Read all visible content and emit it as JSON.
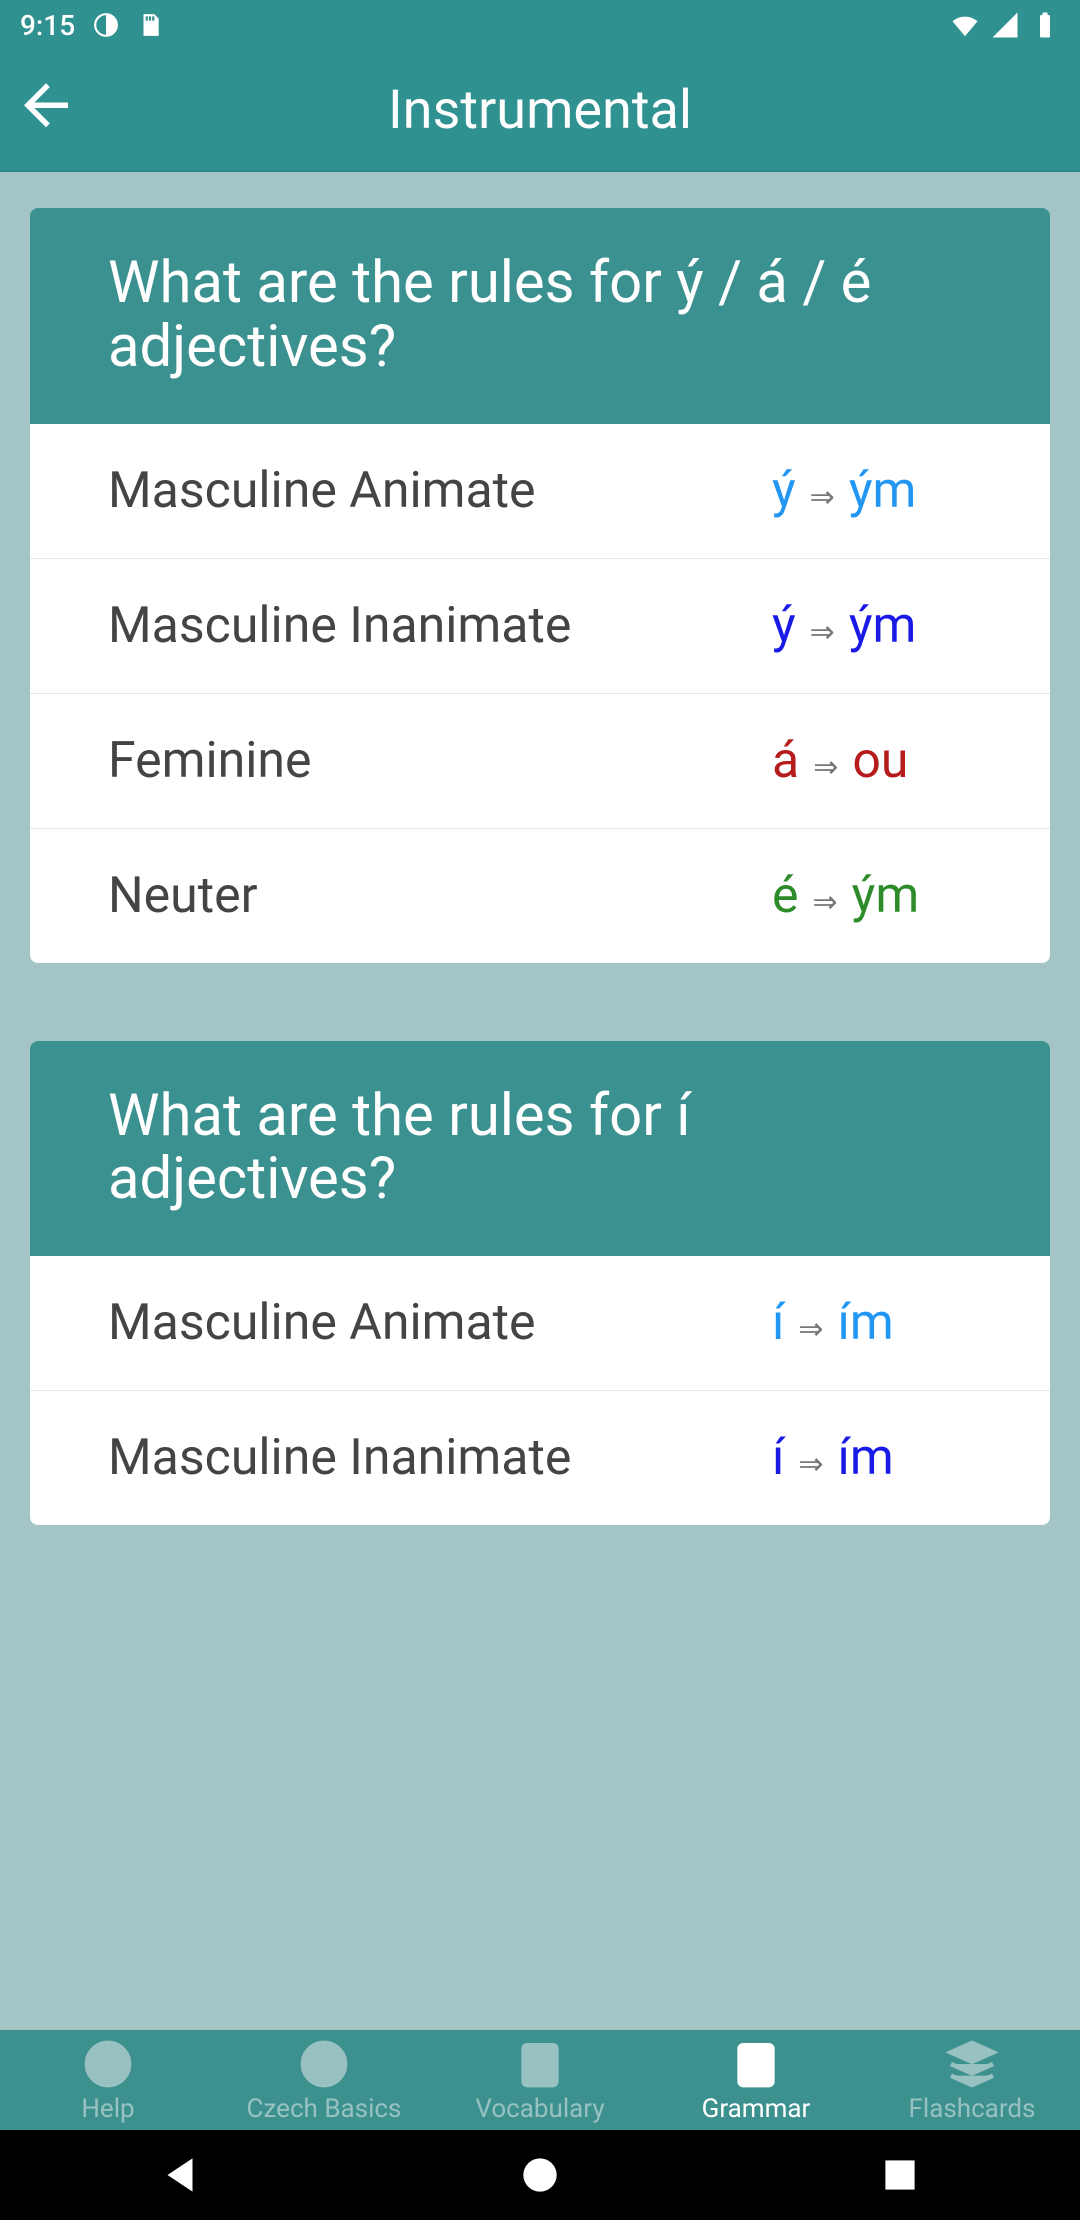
{
  "status": {
    "time": "9:15"
  },
  "header": {
    "title": "Instrumental"
  },
  "sections": [
    {
      "title": "What are the rules for ý / á / é adjectives?",
      "rows": [
        {
          "label": "Masculine Animate",
          "from": "ý",
          "to": "ým",
          "colorClass": "color-animate"
        },
        {
          "label": "Masculine Inanimate",
          "from": "ý",
          "to": "ým",
          "colorClass": "color-inanimate"
        },
        {
          "label": "Feminine",
          "from": "á",
          "to": "ou",
          "colorClass": "color-feminine"
        },
        {
          "label": "Neuter",
          "from": "é",
          "to": "ým",
          "colorClass": "color-neuter"
        }
      ]
    },
    {
      "title": "What are the rules for í adjectives?",
      "rows": [
        {
          "label": "Masculine Animate",
          "from": "í",
          "to": "ím",
          "colorClass": "color-animate"
        },
        {
          "label": "Masculine Inanimate",
          "from": "í",
          "to": "ím",
          "colorClass": "color-inanimate"
        }
      ]
    }
  ],
  "tabs": [
    {
      "name": "help",
      "label": "Help",
      "active": false
    },
    {
      "name": "basics",
      "label": "Czech Basics",
      "active": false
    },
    {
      "name": "vocabulary",
      "label": "Vocabulary",
      "active": false
    },
    {
      "name": "grammar",
      "label": "Grammar",
      "active": true
    },
    {
      "name": "flashcards",
      "label": "Flashcards",
      "active": false
    }
  ]
}
